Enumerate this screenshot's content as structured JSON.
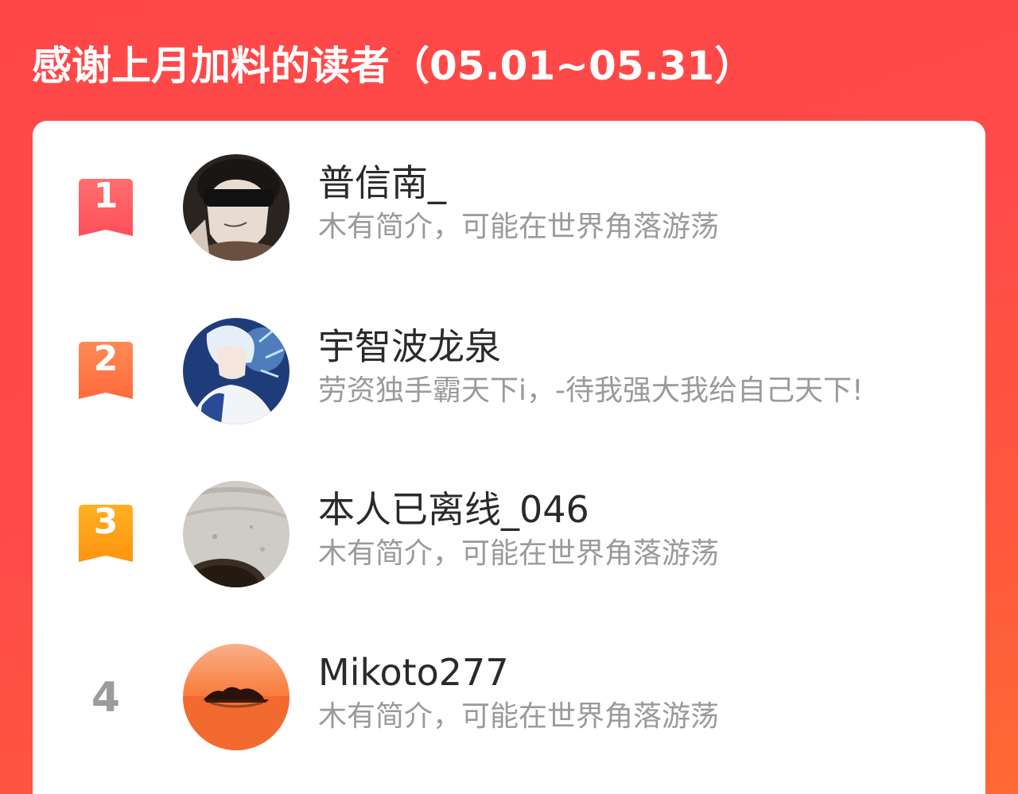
{
  "header": {
    "title": "感谢上月加料的读者（05.01~05.31）"
  },
  "colors": {
    "background": "#ff4a4a",
    "card": "#ffffff",
    "rank1": "#ff5c62",
    "rank2": "#ff7a45",
    "rank3": "#ffa21a",
    "rank_plain": "#9b9b9b",
    "name_text": "#2a2a2a",
    "bio_text": "#9a9a9a"
  },
  "readers": [
    {
      "rank": "1",
      "name": "普信南_",
      "bio": "木有简介，可能在世界角落游荡",
      "avatar_icon": "anime-avatar-blindfold"
    },
    {
      "rank": "2",
      "name": "宇智波龙泉",
      "bio": "劳资独手霸天下i，-待我强大我给自己天下!",
      "avatar_icon": "anime-avatar-blue"
    },
    {
      "rank": "3",
      "name": "本人已离线_046",
      "bio": "木有简介，可能在世界角落游荡",
      "avatar_icon": "stone-texture-avatar"
    },
    {
      "rank": "4",
      "name": "Mikoto277",
      "bio": "木有简介，可能在世界角落游荡",
      "avatar_icon": "sunset-lake-avatar"
    }
  ]
}
